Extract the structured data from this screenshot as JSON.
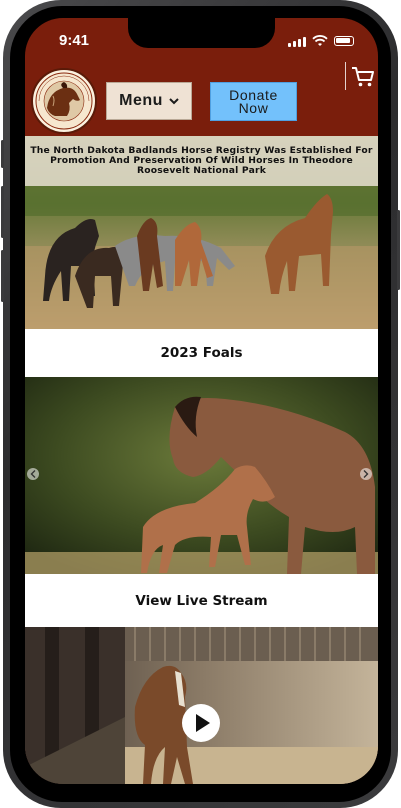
{
  "status_bar": {
    "time": "9:41"
  },
  "header": {
    "logo_text_top": "North Dakota",
    "logo_text_bottom": "Badlands Horse",
    "menu_label": "Menu",
    "donate_label": "Donate Now"
  },
  "hero": {
    "banner_text": "The North Dakota Badlands Horse Registry Was Established For Promotion And Preservation Of Wild Horses In Theodore Roosevelt National Park"
  },
  "sections": [
    {
      "caption": "2023 Foals"
    },
    {
      "caption": "View Live Stream"
    }
  ],
  "colors": {
    "brand_red": "#7a1e0c",
    "donate_blue": "#73c1fb",
    "menu_beige": "#efe2d4"
  },
  "icons": [
    "chevron-down-icon",
    "cart-icon",
    "chevron-left-icon",
    "chevron-right-icon",
    "play-icon"
  ]
}
